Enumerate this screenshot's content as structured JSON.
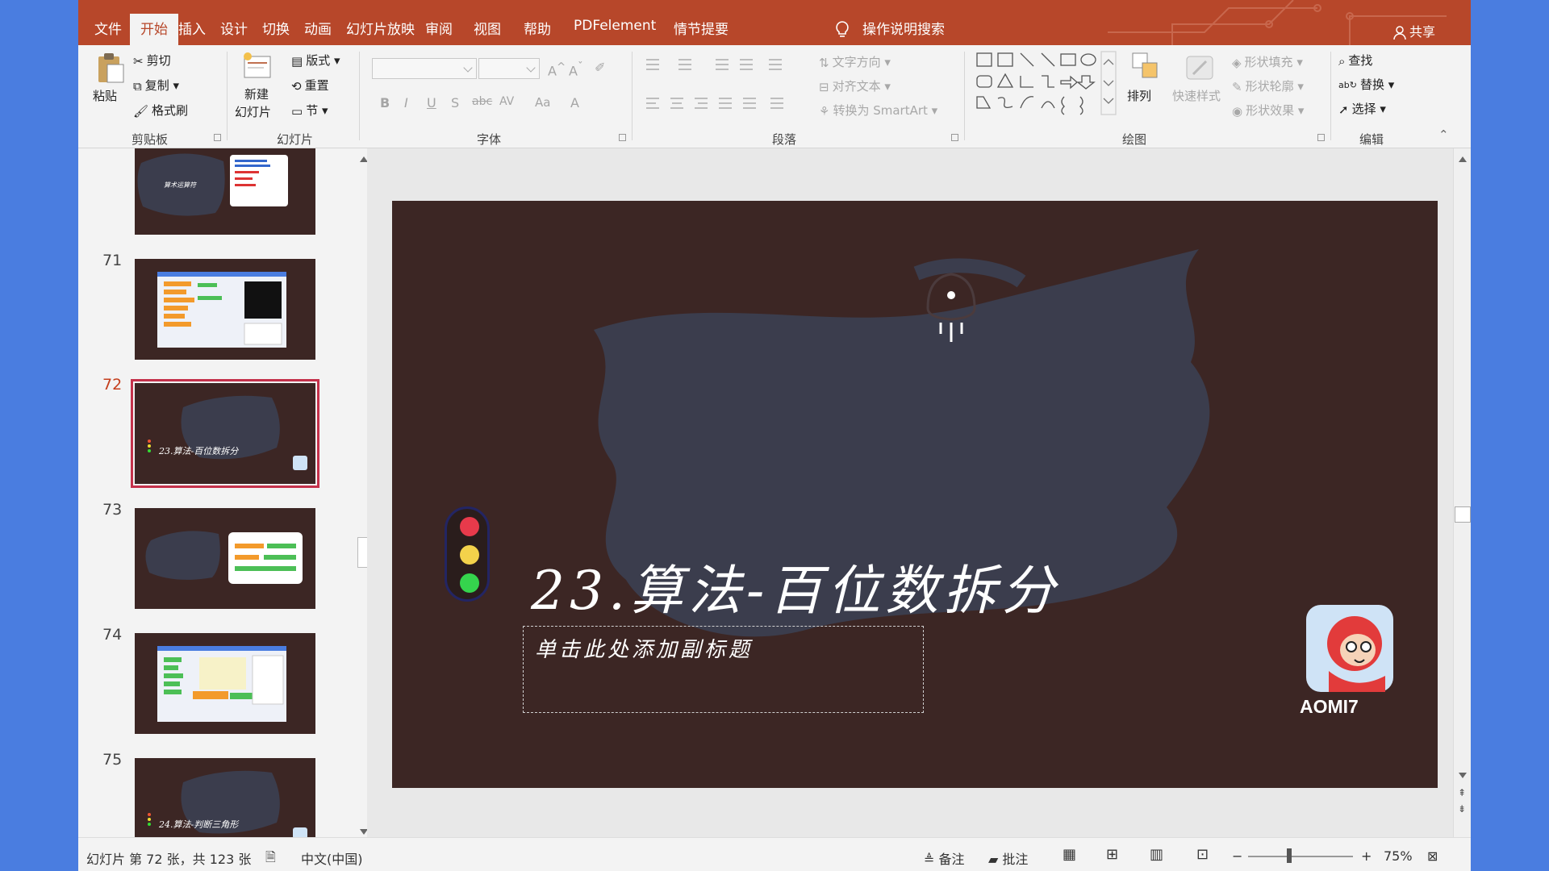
{
  "ribbon_tabs": [
    {
      "label": "文件"
    },
    {
      "label": "开始"
    },
    {
      "label": "插入"
    },
    {
      "label": "设计"
    },
    {
      "label": "切换"
    },
    {
      "label": "动画"
    },
    {
      "label": "幻灯片放映"
    },
    {
      "label": "审阅"
    },
    {
      "label": "视图"
    },
    {
      "label": "帮助"
    },
    {
      "label": "PDFelement"
    },
    {
      "label": "情节提要"
    }
  ],
  "search_label": "操作说明搜索",
  "share_label": "共享",
  "clipboard": {
    "paste": "粘贴",
    "cut": "剪切",
    "copy": "复制",
    "format_painter": "格式刷",
    "group": "剪贴板"
  },
  "slides_group": {
    "new_slide_1": "新建",
    "new_slide_2": "幻灯片",
    "layout": "版式",
    "reset": "重置",
    "section": "节",
    "group": "幻灯片"
  },
  "font_group": {
    "group": "字体",
    "bold": "B",
    "italic": "I",
    "underline": "U",
    "shadow": "S",
    "strike": "abc",
    "spacing": "AV",
    "case": "Aa",
    "color": "A"
  },
  "paragraph_group": {
    "group": "段落",
    "text_direction": "文字方向",
    "align_text": "对齐文本",
    "smartart": "转换为 SmartArt"
  },
  "drawing_group": {
    "group": "绘图",
    "arrange": "排列",
    "quick_styles": "快速样式",
    "fill": "形状填充",
    "outline": "形状轮廓",
    "effects": "形状效果"
  },
  "editing_group": {
    "group": "编辑",
    "find": "查找",
    "replace": "替换",
    "select": "选择"
  },
  "thumbnails": [
    {
      "num": "71"
    },
    {
      "num": "72"
    },
    {
      "num": "73"
    },
    {
      "num": "74"
    },
    {
      "num": "75"
    }
  ],
  "thumb_texts": {
    "t70": "算术运算符",
    "t72": "23.算法-百位数拆分",
    "t75": "24.算法-判断三角形"
  },
  "slide": {
    "title": "23.算法-百位数拆分",
    "subtitle_placeholder": "单击此处添加副标题",
    "logo_text": "AOMI7"
  },
  "status": {
    "slide_info": "幻灯片 第 72 张，共 123 张",
    "language": "中文(中国)",
    "notes": "备注",
    "comments": "批注",
    "zoom": "75%"
  },
  "colors": {
    "accent": "#b7472a",
    "slide_bg": "#3c2624",
    "brush": "#3b3d4d"
  }
}
